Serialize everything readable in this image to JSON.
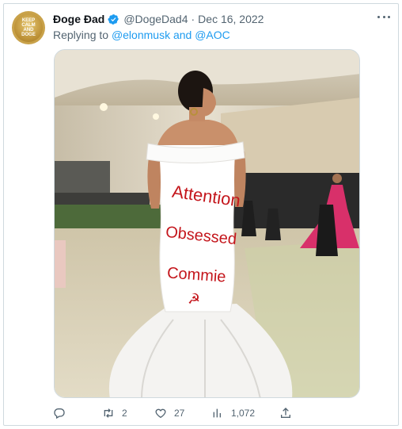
{
  "tweet": {
    "display_name": "Đoge Đad",
    "handle": "@DogeDad4",
    "separator": "·",
    "date": "Dec 16, 2022",
    "replying_prefix": "Replying to",
    "replying_mentions": "@elonmusk and @AOC",
    "avatar_text": [
      "KEEP",
      "CALM",
      "AND",
      "DOGE"
    ],
    "media": {
      "dress_text": [
        "Attention",
        "Obsessed",
        "Commie"
      ],
      "symbol": "☭"
    },
    "actions": {
      "reply_count": "",
      "retweet_count": "2",
      "like_count": "27",
      "views_count": "1,072"
    }
  },
  "colors": {
    "accent": "#1d9bf0",
    "secondary_text": "#536471",
    "dress_lettering": "#c4161c"
  },
  "icons": [
    "verified-badge-icon",
    "more-icon",
    "reply-icon",
    "retweet-icon",
    "like-icon",
    "views-icon",
    "share-icon"
  ]
}
